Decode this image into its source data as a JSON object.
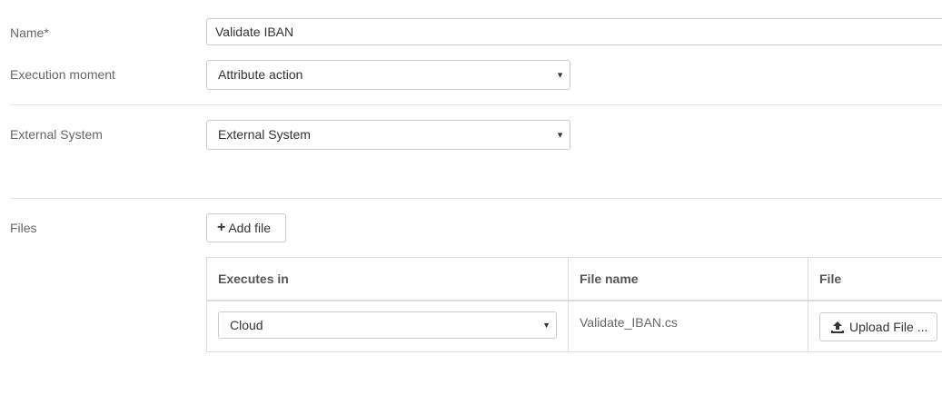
{
  "form": {
    "name_label": "Name*",
    "name_value": "Validate IBAN",
    "execution_moment_label": "Execution moment",
    "execution_moment_value": "Attribute action",
    "external_system_label": "External System",
    "external_system_value": "External System",
    "files_label": "Files",
    "add_file_label": "Add file"
  },
  "files_table": {
    "columns": [
      "Executes in",
      "File name",
      "File"
    ],
    "rows": [
      {
        "executes_in": "Cloud",
        "file_name": "Validate_IBAN.cs",
        "upload_label": "Upload File ..."
      }
    ]
  },
  "icons": {
    "dropdown": "caret-down-icon",
    "add": "plus-icon",
    "upload": "upload-icon"
  }
}
